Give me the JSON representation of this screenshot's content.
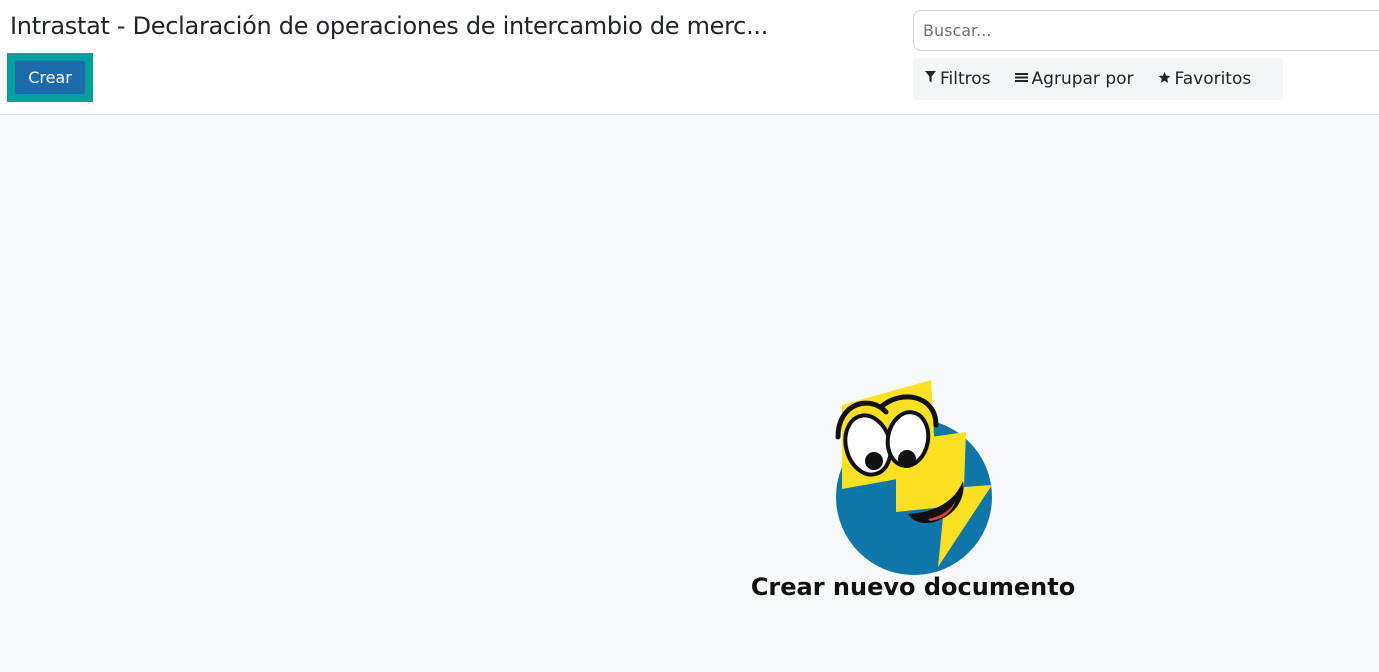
{
  "header": {
    "title": "Intrastat - Declaración de operaciones de intercambio de merc...",
    "create_label": "Crear"
  },
  "search": {
    "placeholder": "Buscar...",
    "value": ""
  },
  "search_options": [
    {
      "label": "Filtros",
      "icon": "filter-icon"
    },
    {
      "label": "Agrupar por",
      "icon": "bars-icon"
    },
    {
      "label": "Favoritos",
      "icon": "star-icon"
    }
  ],
  "empty_state": {
    "title": "Crear nuevo documento",
    "illustration": "smiling-bolt-mascot-icon"
  },
  "colors": {
    "accent": "#00a09d",
    "primary": "#1c6cad",
    "mascot_blue": "#0e76a8",
    "mascot_yellow": "#fde020"
  }
}
